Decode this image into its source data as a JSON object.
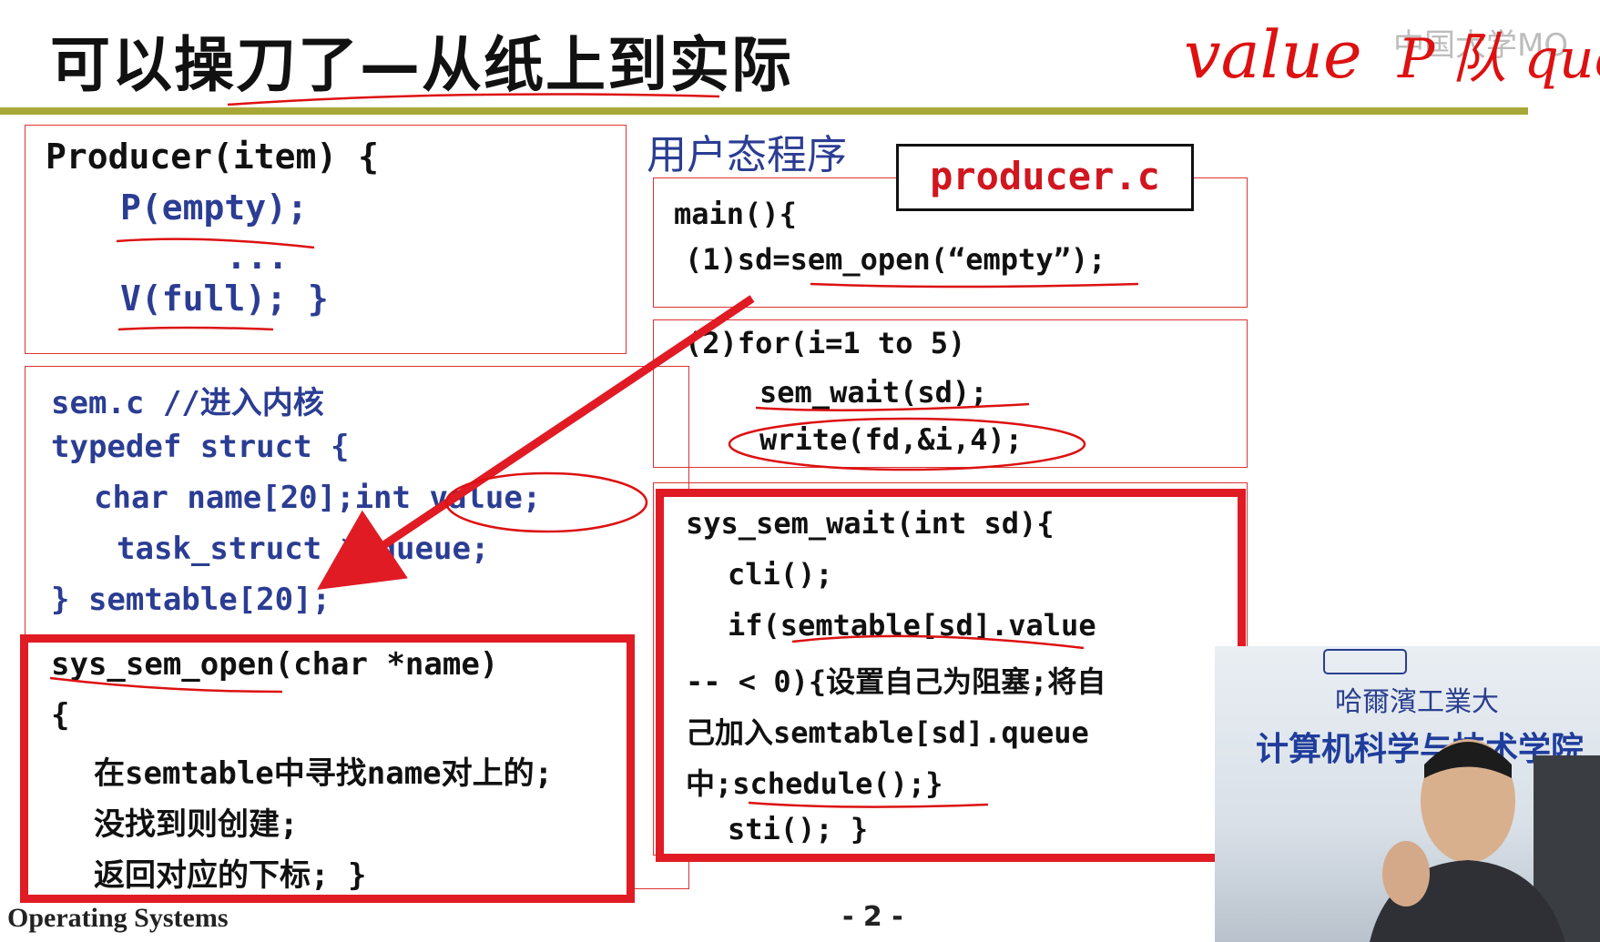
{
  "slide": {
    "title": "可以操刀了—从纸上到实际",
    "watermark": "中国大学MO",
    "user_mode_label": "用户态程序",
    "file_label": "producer.c"
  },
  "producer_box": {
    "lines": [
      "Producer(item) {",
      "P(empty);",
      "...",
      "V(full); }"
    ]
  },
  "sem_box": {
    "lines": [
      "sem.c //进入内核",
      "typedef struct {",
      "char name[20];int value;",
      "task_struct * queue;",
      "} semtable[20];"
    ]
  },
  "sys_sem_open_box": {
    "lines": [
      "sys_sem_open(char *name)",
      "{",
      "在semtable中寻找name对上的;",
      "没找到则创建;",
      "返回对应的下标; }"
    ]
  },
  "main_box": {
    "lines": [
      "main(){",
      "(1)sd=sem_open(“empty”);"
    ]
  },
  "loop_box": {
    "lines": [
      "(2)for(i=1 to 5)",
      "sem_wait(sd);",
      "write(fd,&i,4);"
    ]
  },
  "sys_sem_wait_box": {
    "lines": [
      "sys_sem_wait(int sd){",
      "cli();",
      "if(semtable[sd].value",
      "-- < 0){设置自己为阻塞;将自",
      "己加入semtable[sd].queue",
      "中;schedule();}",
      "sti(); }"
    ]
  },
  "annotations": {
    "handwritten_top": "value",
    "handwritten_top2": "P 队 que"
  },
  "footer": {
    "course": "Operating Systems",
    "page": "- 2 -"
  },
  "video": {
    "line1": "哈爾濱工業大",
    "line2": "计算机科学与技术学院"
  },
  "colors": {
    "accent_red": "#e01b24",
    "code_blue": "#2b3d93",
    "rule_olive": "#a8a838"
  }
}
